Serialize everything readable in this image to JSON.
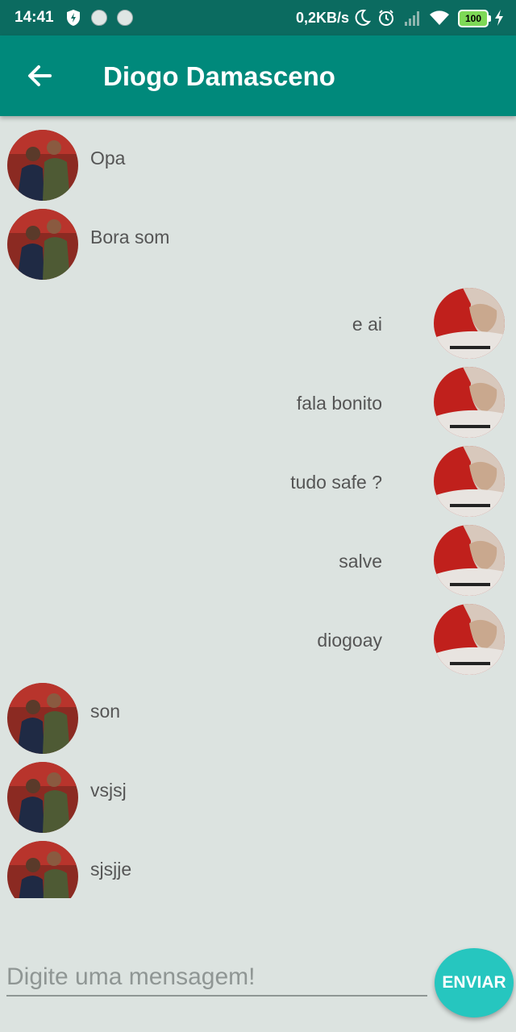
{
  "status_bar": {
    "time": "14:41",
    "network_speed": "0,2KB/s",
    "battery": "100",
    "icons": [
      "shield-icon",
      "notification-dot-icon",
      "notification-dot-icon",
      "moon-icon",
      "alarm-icon",
      "signal-icon",
      "wifi-icon",
      "battery-icon",
      "charging-icon"
    ]
  },
  "header": {
    "title": "Diogo Damasceno",
    "back_icon": "arrow-left-icon"
  },
  "messages": [
    {
      "side": "received",
      "text": "Opa"
    },
    {
      "side": "received",
      "text": "Bora som"
    },
    {
      "side": "sent",
      "text": "e ai"
    },
    {
      "side": "sent",
      "text": "fala bonito"
    },
    {
      "side": "sent",
      "text": "tudo safe ?"
    },
    {
      "side": "sent",
      "text": "salve"
    },
    {
      "side": "sent",
      "text": "diogoay"
    },
    {
      "side": "received",
      "text": "son"
    },
    {
      "side": "received",
      "text": "vsjsj"
    },
    {
      "side": "received",
      "text": "sjsjje"
    }
  ],
  "composer": {
    "placeholder": "Digite uma mensagem!",
    "value": "",
    "send_label": "ENVIAR"
  },
  "colors": {
    "status_bar": "#0b6b60",
    "app_bar": "#00897b",
    "background": "#dce3e0",
    "send_button": "#26c6bf"
  }
}
